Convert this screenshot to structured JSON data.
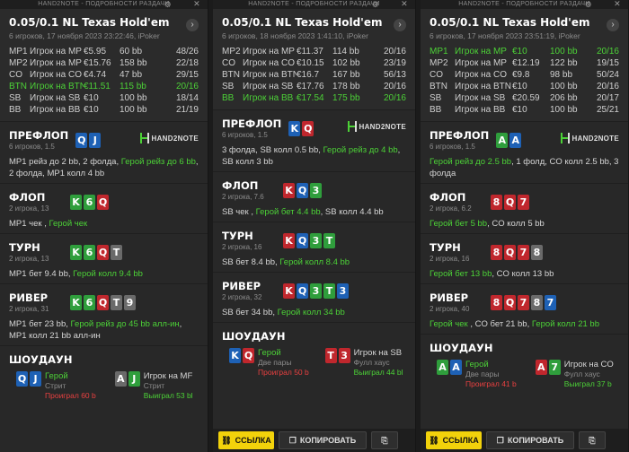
{
  "panels": [
    {
      "titlebar": "HAND2NOTE - ПОДРОБНОСТИ РАЗДАЧИ",
      "title": "0.05/0.1 NL Texas Hold'em",
      "subtitle": "6 игроков, 17 ноября 2023 23:22:46, iPoker",
      "players": [
        {
          "pos": "MP1",
          "name": "Игрок на MP",
          "stack": "€5.95",
          "bb": "60 bb",
          "hands": "48/26",
          "hero": false
        },
        {
          "pos": "MP2",
          "name": "Игрок на MP",
          "stack": "€15.76",
          "bb": "158 bb",
          "hands": "22/18",
          "hero": false
        },
        {
          "pos": "CO",
          "name": "Игрок на CO",
          "stack": "€4.74",
          "bb": "47 bb",
          "hands": "29/15",
          "hero": false
        },
        {
          "pos": "BTN",
          "name": "Игрок на BTN",
          "stack": "€11.51",
          "bb": "115 bb",
          "hands": "20/16",
          "hero": true
        },
        {
          "pos": "SB",
          "name": "Игрок на SB",
          "stack": "€10",
          "bb": "100 bb",
          "hands": "18/14",
          "hero": false
        },
        {
          "pos": "BB",
          "name": "Игрок на BB",
          "stack": "€10",
          "bb": "100 bb",
          "hands": "21/19",
          "hero": false
        }
      ],
      "streets": [
        {
          "name": "ПРЕФЛОП",
          "pot": "6 игроков, 1.5",
          "logo": "HAND2NOTE",
          "cards": [
            {
              "r": "Q",
              "c": "blue"
            },
            {
              "r": "J",
              "c": "blue"
            }
          ],
          "actions": [
            {
              "t": "MP1 рейз до 2 bb",
              "h": false
            },
            {
              "t": ", 2 фолда, ",
              "h": false
            },
            {
              "t": "Герой рейз до 6 bb",
              "h": true
            },
            {
              "t": ", 2 фолда, MP1 колл 4 bb",
              "h": false
            }
          ]
        },
        {
          "name": "ФЛОП",
          "pot": "2 игрока, 13",
          "cards": [
            {
              "r": "K",
              "c": "green"
            },
            {
              "r": "6",
              "c": "green"
            },
            {
              "r": "Q",
              "c": "red"
            }
          ],
          "actions": [
            {
              "t": "MP1 чек , ",
              "h": false
            },
            {
              "t": "Герой чек",
              "h": true
            }
          ]
        },
        {
          "name": "ТУРН",
          "pot": "2 игрока, 13",
          "cards": [
            {
              "r": "K",
              "c": "green"
            },
            {
              "r": "6",
              "c": "green"
            },
            {
              "r": "Q",
              "c": "red"
            },
            {
              "r": "T",
              "c": "grey"
            }
          ],
          "actions": [
            {
              "t": "MP1 бет 9.4 bb, ",
              "h": false
            },
            {
              "t": "Герой колл 9.4 bb",
              "h": true
            }
          ]
        },
        {
          "name": "РИВЕР",
          "pot": "2 игрока, 31",
          "cards": [
            {
              "r": "K",
              "c": "green"
            },
            {
              "r": "6",
              "c": "green"
            },
            {
              "r": "Q",
              "c": "red"
            },
            {
              "r": "T",
              "c": "grey"
            },
            {
              "r": "9",
              "c": "grey"
            }
          ],
          "actions": [
            {
              "t": "MP1 бет 23 bb, ",
              "h": false
            },
            {
              "t": "Герой рейз до 45 bb алл-ин",
              "h": true
            },
            {
              "t": ", MP1 колл 21 bb алл-ин",
              "h": false
            }
          ]
        }
      ],
      "showdown": {
        "name": "ШОУДАУН",
        "left": {
          "cards": [
            {
              "r": "Q",
              "c": "blue"
            },
            {
              "r": "J",
              "c": "blue"
            }
          ],
          "player": "Герой",
          "hand": "Стрит",
          "result": "Проиграл 60 b",
          "hero": true,
          "win": false
        },
        "right": {
          "cards": [
            {
              "r": "A",
              "c": "grey"
            },
            {
              "r": "J",
              "c": "green"
            }
          ],
          "player": "Игрок на MF",
          "hand": "Стрит",
          "result": "Выиграл 53 bl",
          "hero": false,
          "win": true
        }
      }
    },
    {
      "titlebar": "HAND2NOTE - ПОДРОБНОСТИ РАЗДАЧИ",
      "title": "0.05/0.1 NL Texas Hold'em",
      "subtitle": "6 игроков, 18 ноября 2023 1:41:10, iPoker",
      "players": [
        {
          "pos": "MP2",
          "name": "Игрок на MP",
          "stack": "€11.37",
          "bb": "114 bb",
          "hands": "20/16",
          "hero": false
        },
        {
          "pos": "CO",
          "name": "Игрок на CO",
          "stack": "€10.15",
          "bb": "102 bb",
          "hands": "23/19",
          "hero": false
        },
        {
          "pos": "BTN",
          "name": "Игрок на BTN",
          "stack": "€16.7",
          "bb": "167 bb",
          "hands": "56/13",
          "hero": false
        },
        {
          "pos": "SB",
          "name": "Игрок на SB",
          "stack": "€17.76",
          "bb": "178 bb",
          "hands": "20/16",
          "hero": false
        },
        {
          "pos": "BB",
          "name": "Игрок на BB (",
          "stack": "€17.54",
          "bb": "175 bb",
          "hands": "20/16",
          "hero": true
        }
      ],
      "streets": [
        {
          "name": "ПРЕФЛОП",
          "pot": "6 игроков, 1.5",
          "logo": "HAND2NOTE",
          "cards": [
            {
              "r": "K",
              "c": "blue"
            },
            {
              "r": "Q",
              "c": "red"
            }
          ],
          "actions": [
            {
              "t": "3 фолда, SB колл 0.5 bb, ",
              "h": false
            },
            {
              "t": "Герой рейз до 4 bb",
              "h": true
            },
            {
              "t": ", SB колл 3 bb",
              "h": false
            }
          ]
        },
        {
          "name": "ФЛОП",
          "pot": "2 игрока, 7.6",
          "cards": [
            {
              "r": "K",
              "c": "red"
            },
            {
              "r": "Q",
              "c": "blue"
            },
            {
              "r": "3",
              "c": "green"
            }
          ],
          "actions": [
            {
              "t": "SB чек , ",
              "h": false
            },
            {
              "t": "Герой бет 4.4 bb",
              "h": true
            },
            {
              "t": ", SB колл 4.4 bb",
              "h": false
            }
          ]
        },
        {
          "name": "ТУРН",
          "pot": "2 игрока, 16",
          "cards": [
            {
              "r": "K",
              "c": "red"
            },
            {
              "r": "Q",
              "c": "blue"
            },
            {
              "r": "3",
              "c": "green"
            },
            {
              "r": "T",
              "c": "green"
            }
          ],
          "actions": [
            {
              "t": "SB бет 8.4 bb, ",
              "h": false
            },
            {
              "t": "Герой колл 8.4 bb",
              "h": true
            }
          ]
        },
        {
          "name": "РИВЕР",
          "pot": "2 игрока, 32",
          "cards": [
            {
              "r": "K",
              "c": "red"
            },
            {
              "r": "Q",
              "c": "blue"
            },
            {
              "r": "3",
              "c": "green"
            },
            {
              "r": "T",
              "c": "green"
            },
            {
              "r": "3",
              "c": "blue"
            }
          ],
          "actions": [
            {
              "t": "SB бет 34 bb, ",
              "h": false
            },
            {
              "t": "Герой колл 34 bb",
              "h": true
            }
          ]
        }
      ],
      "showdown": {
        "name": "ШОУДАУН",
        "left": {
          "cards": [
            {
              "r": "K",
              "c": "blue"
            },
            {
              "r": "Q",
              "c": "red"
            }
          ],
          "player": "Герой",
          "hand": "Две пары",
          "result": "Проиграл 50 b",
          "hero": true,
          "win": false
        },
        "right": {
          "cards": [
            {
              "r": "T",
              "c": "red"
            },
            {
              "r": "3",
              "c": "red"
            }
          ],
          "player": "Игрок на SB",
          "hand": "Фулл хаус",
          "result": "Выиграл 44 bl",
          "hero": false,
          "win": true
        }
      }
    },
    {
      "titlebar": "HAND2NOTE - ПОДРОБНОСТИ РАЗДАЧИ",
      "title": "0.05/0.1 NL Texas Hold'em",
      "subtitle": "6 игроков, 17 ноября 2023 23:51:19, iPoker",
      "players": [
        {
          "pos": "MP1",
          "name": "Игрок на MP",
          "stack": "€10",
          "bb": "100 bb",
          "hands": "20/16",
          "hero": true
        },
        {
          "pos": "MP2",
          "name": "Игрок на MP",
          "stack": "€12.19",
          "bb": "122 bb",
          "hands": "19/15",
          "hero": false
        },
        {
          "pos": "CO",
          "name": "Игрок на CO",
          "stack": "€9.8",
          "bb": "98 bb",
          "hands": "50/24",
          "hero": false
        },
        {
          "pos": "BTN",
          "name": "Игрок на BTN",
          "stack": "€10",
          "bb": "100 bb",
          "hands": "20/16",
          "hero": false
        },
        {
          "pos": "SB",
          "name": "Игрок на SB",
          "stack": "€20.59",
          "bb": "206 bb",
          "hands": "20/17",
          "hero": false
        },
        {
          "pos": "BB",
          "name": "Игрок на BB",
          "stack": "€10",
          "bb": "100 bb",
          "hands": "25/21",
          "hero": false
        }
      ],
      "streets": [
        {
          "name": "ПРЕФЛОП",
          "pot": "6 игроков, 1.5",
          "logo": "HAND2NOTE",
          "cards": [
            {
              "r": "A",
              "c": "green"
            },
            {
              "r": "A",
              "c": "blue"
            }
          ],
          "actions": [
            {
              "t": "Герой рейз до 2.5 bb",
              "h": true
            },
            {
              "t": ", 1 фолд, CO колл 2.5 bb, 3 фолда",
              "h": false
            }
          ]
        },
        {
          "name": "ФЛОП",
          "pot": "2 игрока, 6.2",
          "cards": [
            {
              "r": "8",
              "c": "red"
            },
            {
              "r": "Q",
              "c": "red"
            },
            {
              "r": "7",
              "c": "red"
            }
          ],
          "actions": [
            {
              "t": "Герой бет 5 bb",
              "h": true
            },
            {
              "t": ", CO колл 5 bb",
              "h": false
            }
          ]
        },
        {
          "name": "ТУРН",
          "pot": "2 игрока, 16",
          "cards": [
            {
              "r": "8",
              "c": "red"
            },
            {
              "r": "Q",
              "c": "red"
            },
            {
              "r": "7",
              "c": "red"
            },
            {
              "r": "8",
              "c": "grey"
            }
          ],
          "actions": [
            {
              "t": "Герой бет 13 bb",
              "h": true
            },
            {
              "t": ", CO колл 13 bb",
              "h": false
            }
          ]
        },
        {
          "name": "РИВЕР",
          "pot": "2 игрока, 40",
          "cards": [
            {
              "r": "8",
              "c": "red"
            },
            {
              "r": "Q",
              "c": "red"
            },
            {
              "r": "7",
              "c": "red"
            },
            {
              "r": "8",
              "c": "grey"
            },
            {
              "r": "7",
              "c": "blue"
            }
          ],
          "actions": [
            {
              "t": "Герой чек",
              "h": true
            },
            {
              "t": " , CO бет 21 bb, ",
              "h": false
            },
            {
              "t": "Герой колл 21 bb",
              "h": true
            }
          ]
        }
      ],
      "showdown": {
        "name": "ШОУДАУН",
        "left": {
          "cards": [
            {
              "r": "A",
              "c": "green"
            },
            {
              "r": "A",
              "c": "blue"
            }
          ],
          "player": "Герой",
          "hand": "Две пары",
          "result": "Проиграл 41 b",
          "hero": true,
          "win": false
        },
        "right": {
          "cards": [
            {
              "r": "A",
              "c": "red"
            },
            {
              "r": "7",
              "c": "green"
            }
          ],
          "player": "Игрок на CO",
          "hand": "Фулл хаус",
          "result": "Выиграл 37 b",
          "hero": false,
          "win": true
        }
      }
    }
  ],
  "buttons": {
    "link": "ССЫЛКА",
    "copy": "КОПИРОВАТЬ",
    "save": "⎘"
  },
  "icons": {
    "gear": "⚙",
    "close": "✕",
    "nav": "›",
    "link": "⛓",
    "copy": "❐"
  },
  "colors": {
    "hero": "#4cd137",
    "lose": "#e84040",
    "accent": "#f2d20b"
  }
}
